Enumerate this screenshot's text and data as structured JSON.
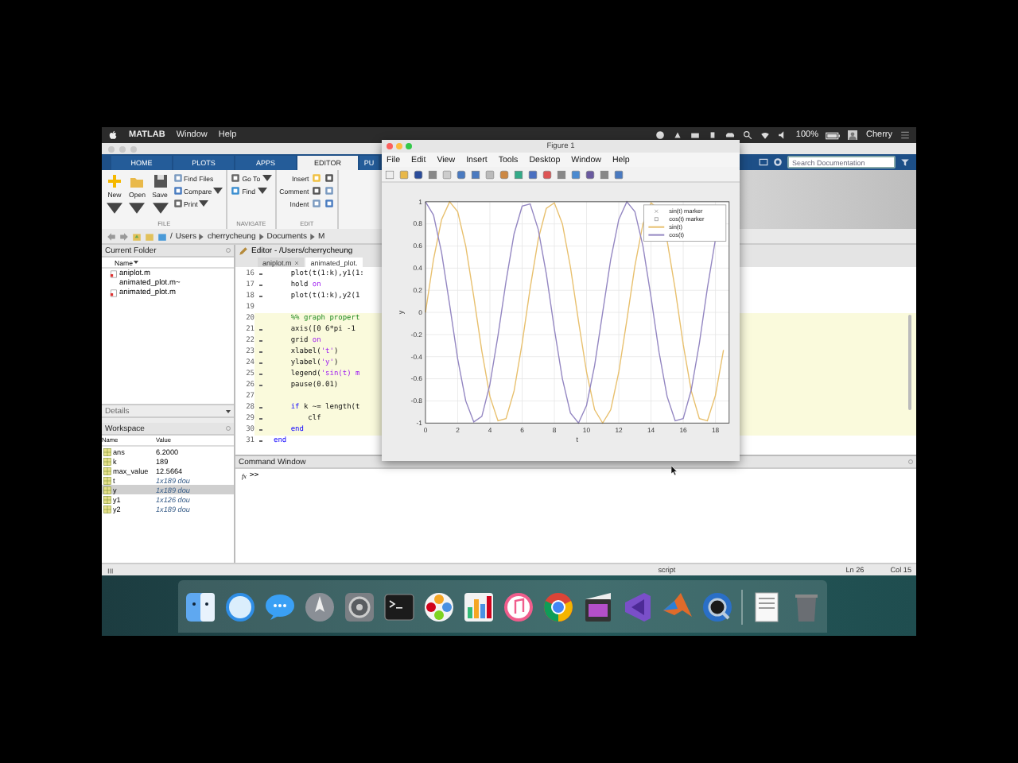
{
  "menubar": {
    "app": "MATLAB",
    "menus": [
      "Window",
      "Help"
    ],
    "battery": "100%",
    "user": "Cherry"
  },
  "matlab": {
    "tabs": [
      {
        "label": "HOME",
        "selected": false
      },
      {
        "label": "PLOTS",
        "selected": false
      },
      {
        "label": "APPS",
        "selected": false
      },
      {
        "label": "EDITOR",
        "selected": true
      },
      {
        "label": "PU",
        "selected": false
      }
    ],
    "search": {
      "placeholder": "Search Documentation"
    },
    "toolstrip": [
      {
        "label": "FILE",
        "items": [
          {
            "label": "New",
            "kind": "big",
            "caret": true
          },
          {
            "label": "Open",
            "kind": "big",
            "caret": true
          },
          {
            "label": "Save",
            "kind": "big",
            "caret": true
          },
          {
            "label": "Find Files",
            "kind": "small",
            "caret": false
          },
          {
            "label": "Compare",
            "kind": "small",
            "caret": true
          },
          {
            "label": "Print",
            "kind": "small",
            "caret": true
          }
        ]
      },
      {
        "label": "NAVIGATE",
        "items": [
          {
            "label": "Go To",
            "kind": "small",
            "caret": true
          },
          {
            "label": "Find",
            "kind": "small",
            "caret": true
          }
        ]
      },
      {
        "label": "EDIT",
        "items": [
          {
            "label": "Insert",
            "kind": "row"
          },
          {
            "label": "Comment",
            "kind": "row"
          },
          {
            "label": "Indent",
            "kind": "row"
          }
        ]
      }
    ],
    "path": [
      "/",
      "Users",
      "cherrycheung",
      "Documents",
      "M"
    ],
    "current_folder": {
      "title": "Current Folder",
      "column": "Name",
      "files": [
        {
          "name": "aniplot.m",
          "kind": "m"
        },
        {
          "name": "animated_plot.m~",
          "kind": "other"
        },
        {
          "name": "animated_plot.m",
          "kind": "m"
        }
      ]
    },
    "details": "Details",
    "workspace": {
      "title": "Workspace",
      "columns": [
        "Name",
        "Value"
      ],
      "rows": [
        {
          "name": "ans",
          "value": "6.2000",
          "kind": "scalar",
          "selected": false
        },
        {
          "name": "k",
          "value": "189",
          "kind": "scalar",
          "selected": false
        },
        {
          "name": "max_value",
          "value": "12.5664",
          "kind": "scalar",
          "selected": false
        },
        {
          "name": "t",
          "value": "1x189 dou",
          "kind": "array",
          "selected": false
        },
        {
          "name": "y",
          "value": "1x189 dou",
          "kind": "array",
          "selected": true
        },
        {
          "name": "y1",
          "value": "1x126 dou",
          "kind": "array",
          "selected": false
        },
        {
          "name": "y2",
          "value": "1x189 dou",
          "kind": "array",
          "selected": false
        }
      ]
    },
    "editor": {
      "title": "Editor - /Users/cherrycheung",
      "tabs": [
        {
          "label": "aniplot.m",
          "selected": false
        },
        {
          "label": "animated_plot.",
          "selected": true
        }
      ],
      "lines": [
        {
          "number": "16",
          "executable": true,
          "cell": false,
          "tokens": [
            {
              "text": "    plot(t(1:k),y1(1:",
              "kind": "plain"
            }
          ]
        },
        {
          "number": "17",
          "executable": true,
          "cell": false,
          "tokens": [
            {
              "text": "    hold ",
              "kind": "plain"
            },
            {
              "text": "on",
              "kind": "str"
            }
          ]
        },
        {
          "number": "18",
          "executable": true,
          "cell": false,
          "tokens": [
            {
              "text": "    plot(t(1:k),y2(1",
              "kind": "plain"
            }
          ]
        },
        {
          "number": "19",
          "executable": false,
          "cell": false
        },
        {
          "number": "20",
          "executable": false,
          "cell": true,
          "tokens": [
            {
              "text": "    %% graph propert",
              "kind": "comment"
            }
          ]
        },
        {
          "number": "21",
          "executable": true,
          "cell": true,
          "tokens": [
            {
              "text": "    axis([0 6*pi -1",
              "kind": "plain"
            }
          ]
        },
        {
          "number": "22",
          "executable": true,
          "cell": true,
          "tokens": [
            {
              "text": "    grid ",
              "kind": "plain"
            },
            {
              "text": "on",
              "kind": "str"
            }
          ]
        },
        {
          "number": "23",
          "executable": true,
          "cell": true,
          "tokens": [
            {
              "text": "    xlabel(",
              "kind": "plain"
            },
            {
              "text": "'t'",
              "kind": "str"
            },
            {
              "text": ")",
              "kind": "plain"
            }
          ]
        },
        {
          "number": "24",
          "executable": true,
          "cell": true,
          "tokens": [
            {
              "text": "    ylabel(",
              "kind": "plain"
            },
            {
              "text": "'y'",
              "kind": "str"
            },
            {
              "text": ")",
              "kind": "plain"
            }
          ]
        },
        {
          "number": "25",
          "executable": true,
          "cell": true,
          "tokens": [
            {
              "text": "    legend(",
              "kind": "plain"
            },
            {
              "text": "'sin(t) m",
              "kind": "str"
            }
          ]
        },
        {
          "number": "26",
          "executable": true,
          "cell": true,
          "tokens": [
            {
              "text": "    pause(0.01)",
              "kind": "plain"
            }
          ]
        },
        {
          "number": "27",
          "executable": false,
          "cell": true
        },
        {
          "number": "28",
          "executable": true,
          "cell": true,
          "tokens": [
            {
              "text": "    if",
              "kind": "kw"
            },
            {
              "text": " k ~= length(t",
              "kind": "plain"
            }
          ]
        },
        {
          "number": "29",
          "executable": true,
          "cell": true,
          "tokens": [
            {
              "text": "        clf",
              "kind": "plain"
            }
          ]
        },
        {
          "number": "30",
          "executable": true,
          "cell": true,
          "tokens": [
            {
              "text": "    end",
              "kind": "kw"
            }
          ]
        },
        {
          "number": "31",
          "executable": true,
          "cell": false,
          "tokens": [
            {
              "text": "end",
              "kind": "kw"
            }
          ]
        }
      ]
    },
    "command_window": {
      "title": "Command Window",
      "hint": "fx",
      "prompt": ">>"
    },
    "status_bar": {
      "mode": "script",
      "line": "Ln 26",
      "column": "Col 15"
    }
  },
  "figure": {
    "title": "Figure 1",
    "menus": [
      "File",
      "Edit",
      "View",
      "Insert",
      "Tools",
      "Desktop",
      "Window",
      "Help"
    ],
    "markers": [
      {
        "label": "sin(t) marker",
        "kind": "x-marker"
      },
      {
        "label": "cos(t) marker",
        "kind": "square-marker"
      }
    ],
    "chart_data": {
      "type": "line",
      "xlabel": "t",
      "ylabel": "y",
      "xlim": [
        0,
        18.85
      ],
      "ylim": [
        -1,
        1
      ],
      "grid": true,
      "legend": true,
      "xticks": [
        0,
        2,
        4,
        6,
        8,
        10,
        12,
        14,
        16,
        18
      ],
      "yticks": [
        -1,
        -0.8,
        -0.6,
        -0.4,
        -0.2,
        0,
        0.2,
        0.4,
        0.6,
        0.8,
        1
      ],
      "x": [
        0,
        0.5,
        1,
        1.5,
        2,
        2.5,
        3,
        3.5,
        4,
        4.5,
        5,
        5.5,
        6,
        6.5,
        7,
        7.5,
        8,
        8.5,
        9,
        9.5,
        10,
        10.5,
        11,
        11.5,
        12,
        12.5,
        13,
        13.5,
        14,
        14.5,
        15,
        15.5,
        16,
        16.5,
        17,
        17.5,
        18,
        18.5
      ],
      "series": [
        {
          "name": "sin(t)",
          "color": "#e8c06e",
          "values": [
            0,
            0.48,
            0.84,
            1,
            0.91,
            0.6,
            0.14,
            -0.35,
            -0.76,
            -0.98,
            -0.96,
            -0.71,
            -0.28,
            0.22,
            0.66,
            0.94,
            0.99,
            0.8,
            0.41,
            -0.08,
            -0.54,
            -0.88,
            -1,
            -0.88,
            -0.54,
            -0.07,
            0.42,
            0.8,
            0.99,
            0.93,
            0.65,
            0.21,
            -0.29,
            -0.71,
            -0.96,
            -0.98,
            -0.75,
            -0.34
          ]
        },
        {
          "name": "cos(t)",
          "color": "#9487c2",
          "values": [
            1,
            0.88,
            0.54,
            0.07,
            -0.42,
            -0.8,
            -0.99,
            -0.94,
            -0.65,
            -0.21,
            0.28,
            0.71,
            0.96,
            0.98,
            0.75,
            0.35,
            -0.15,
            -0.6,
            -0.91,
            -1,
            -0.84,
            -0.48,
            0,
            0.48,
            0.84,
            1,
            0.91,
            0.6,
            0.14,
            -0.36,
            -0.76,
            -0.98,
            -0.96,
            -0.7,
            -0.28,
            0.22,
            0.66,
            null
          ]
        }
      ]
    }
  }
}
